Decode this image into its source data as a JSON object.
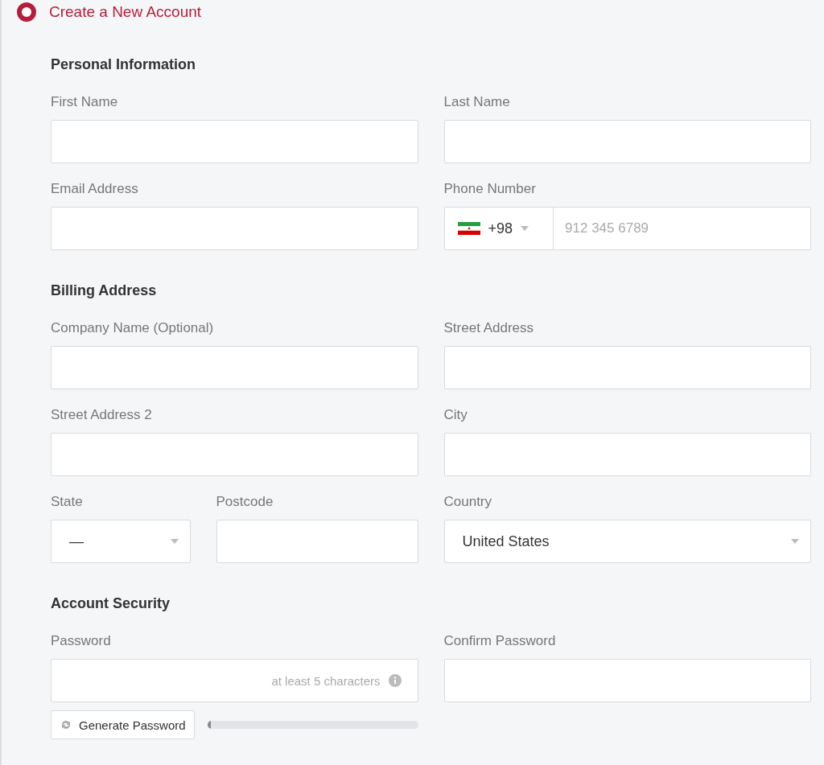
{
  "header": {
    "title": "Create a New Account"
  },
  "sections": [
    {
      "title": "Personal Information",
      "rows": [
        [
          {
            "kind": "text",
            "label": "First Name"
          },
          {
            "kind": "text",
            "label": "Last Name"
          }
        ],
        [
          {
            "kind": "text",
            "label": "Email Address"
          },
          {
            "kind": "phone",
            "label": "Phone Number",
            "code": "+98",
            "placeholder": "912 345 6789"
          }
        ]
      ]
    },
    {
      "title": "Billing Address",
      "rows": [
        [
          {
            "kind": "text",
            "label": "Company Name (Optional)"
          },
          {
            "kind": "text",
            "label": "Street Address"
          }
        ],
        [
          {
            "kind": "text",
            "label": "Street Address 2"
          },
          {
            "kind": "text",
            "label": "City"
          }
        ],
        [
          {
            "kind": "pair",
            "fields": [
              {
                "kind": "select",
                "label": "State",
                "value": "—"
              },
              {
                "kind": "text",
                "label": "Postcode"
              }
            ]
          },
          {
            "kind": "select",
            "label": "Country",
            "value": "United States"
          }
        ]
      ]
    },
    {
      "title": "Account Security",
      "rows": [
        [
          {
            "kind": "password",
            "label": "Password",
            "hint": "at least 5 characters",
            "button": "Generate Password",
            "level": 0.01
          },
          {
            "kind": "text",
            "label": "Confirm Password"
          }
        ]
      ]
    }
  ]
}
